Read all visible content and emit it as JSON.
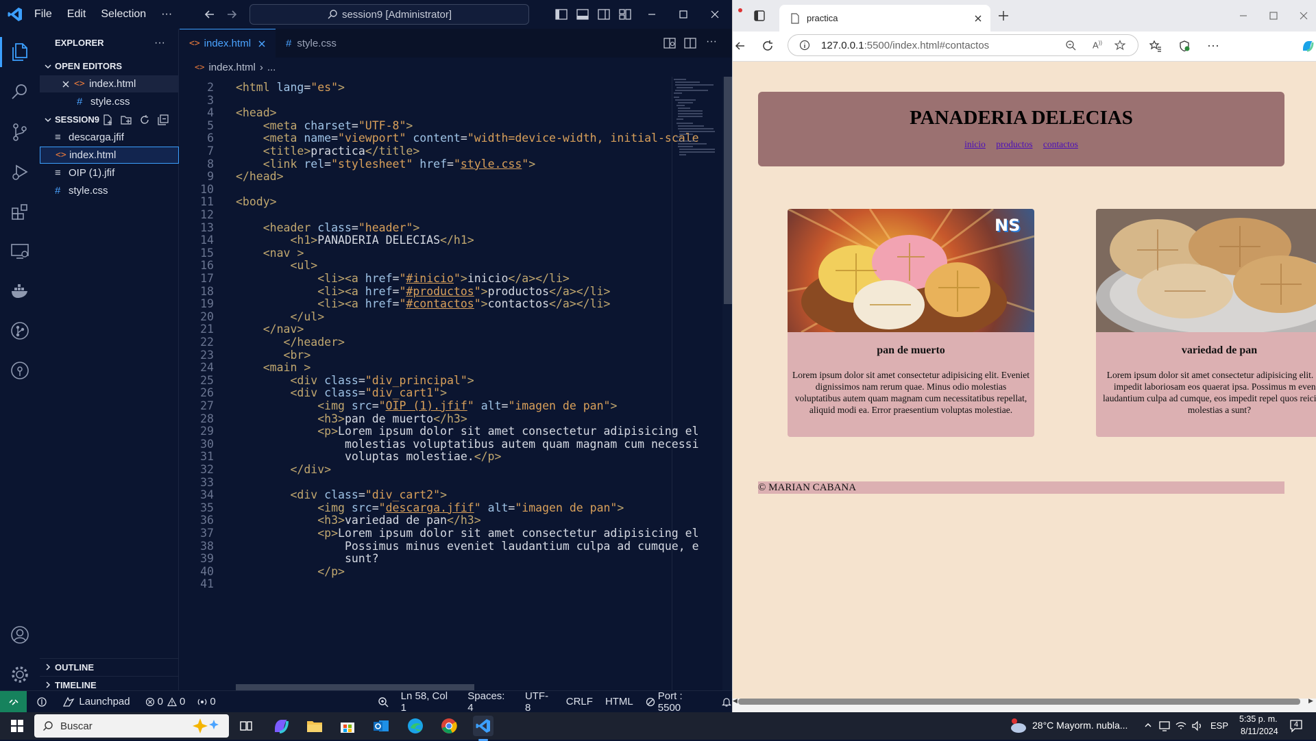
{
  "vscode": {
    "menu": [
      "File",
      "Edit",
      "Selection",
      "···"
    ],
    "command_center": "session9 [Administrator]",
    "explorer": {
      "title": "EXPLORER",
      "open_editors_label": "OPEN EDITORS",
      "open_editors": [
        "index.html",
        "style.css"
      ],
      "folder_label": "SESSION9",
      "files": [
        "descarga.jfif",
        "index.html",
        "OIP (1).jfif",
        "style.css"
      ],
      "outline_label": "OUTLINE",
      "timeline_label": "TIMELINE"
    },
    "tabs": [
      "index.html",
      "style.css"
    ],
    "breadcrumb": [
      "index.html",
      "..."
    ],
    "code_lines": [
      {
        "n": "2",
        "html": "<span class='tg'>&lt;html</span> <span class='at'>lang</span>=<span class='st'>\"es\"</span><span class='tg'>&gt;</span>"
      },
      {
        "n": "3",
        "html": ""
      },
      {
        "n": "4",
        "html": "<span class='tg'>&lt;head&gt;</span>"
      },
      {
        "n": "5",
        "html": "    <span class='tg'>&lt;meta</span> <span class='at'>charset</span>=<span class='st'>\"UTF-8\"</span><span class='tg'>&gt;</span>"
      },
      {
        "n": "6",
        "html": "    <span class='tg'>&lt;meta</span> <span class='at'>name</span>=<span class='st'>\"viewport\"</span> <span class='at'>content</span>=<span class='st'>\"width=device-width, initial-scale</span>"
      },
      {
        "n": "7",
        "html": "    <span class='tg'>&lt;title&gt;</span>practica<span class='tg'>&lt;/title&gt;</span>"
      },
      {
        "n": "8",
        "html": "    <span class='tg'>&lt;link</span> <span class='at'>rel</span>=<span class='st'>\"stylesheet\"</span> <span class='at'>href</span>=<span class='st'>\"</span><span class='lk'>style.css</span><span class='st'>\"</span><span class='tg'>&gt;</span>"
      },
      {
        "n": "9",
        "html": "<span class='tg'>&lt;/head&gt;</span>"
      },
      {
        "n": "10",
        "html": ""
      },
      {
        "n": "11",
        "html": "<span class='tg'>&lt;body&gt;</span>"
      },
      {
        "n": "12",
        "html": ""
      },
      {
        "n": "13",
        "html": "    <span class='tg'>&lt;header</span> <span class='at'>class</span>=<span class='st'>\"header\"</span><span class='tg'>&gt;</span>"
      },
      {
        "n": "14",
        "html": "        <span class='tg'>&lt;h1&gt;</span>PANADERIA DELECIAS<span class='tg'>&lt;/h1&gt;</span>"
      },
      {
        "n": "15",
        "html": "    <span class='tg'>&lt;nav</span> <span class='tg'>&gt;</span>"
      },
      {
        "n": "16",
        "html": "        <span class='tg'>&lt;ul&gt;</span>"
      },
      {
        "n": "17",
        "html": "            <span class='tg'>&lt;li&gt;&lt;a</span> <span class='at'>href</span>=<span class='st'>\"</span><span class='lk'>#inicio</span><span class='st'>\"</span><span class='tg'>&gt;</span>inicio<span class='tg'>&lt;/a&gt;&lt;/li&gt;</span>"
      },
      {
        "n": "18",
        "html": "            <span class='tg'>&lt;li&gt;&lt;a</span> <span class='at'>href</span>=<span class='st'>\"</span><span class='lk'>#productos</span><span class='st'>\"</span><span class='tg'>&gt;</span>productos<span class='tg'>&lt;/a&gt;&lt;/li&gt;</span>"
      },
      {
        "n": "19",
        "html": "            <span class='tg'>&lt;li&gt;&lt;a</span> <span class='at'>href</span>=<span class='st'>\"</span><span class='lk'>#contactos</span><span class='st'>\"</span><span class='tg'>&gt;</span>contactos<span class='tg'>&lt;/a&gt;&lt;/li&gt;</span>"
      },
      {
        "n": "20",
        "html": "        <span class='tg'>&lt;/ul&gt;</span>"
      },
      {
        "n": "21",
        "html": "    <span class='tg'>&lt;/nav&gt;</span>"
      },
      {
        "n": "22",
        "html": "       <span class='tg'>&lt;/header&gt;</span>"
      },
      {
        "n": "23",
        "html": "       <span class='tg'>&lt;br&gt;</span>"
      },
      {
        "n": "24",
        "html": "    <span class='tg'>&lt;main</span> <span class='tg'>&gt;</span>"
      },
      {
        "n": "25",
        "html": "        <span class='tg'>&lt;div</span> <span class='at'>class</span>=<span class='st'>\"div_principal\"</span><span class='tg'>&gt;</span>"
      },
      {
        "n": "26",
        "html": "        <span class='tg'>&lt;div</span> <span class='at'>class</span>=<span class='st'>\"div_cart1\"</span><span class='tg'>&gt;</span>"
      },
      {
        "n": "27",
        "html": "            <span class='tg'>&lt;img</span> <span class='at'>src</span>=<span class='st'>\"</span><span class='lk'>OIP (1).jfif</span><span class='st'>\"</span> <span class='at'>alt</span>=<span class='st'>\"imagen de pan\"</span><span class='tg'>&gt;</span>"
      },
      {
        "n": "28",
        "html": "            <span class='tg'>&lt;h3&gt;</span>pan de muerto<span class='tg'>&lt;/h3&gt;</span>"
      },
      {
        "n": "29",
        "html": "            <span class='tg'>&lt;p&gt;</span>Lorem ipsum dolor sit amet consectetur adipisicing el"
      },
      {
        "n": "30",
        "html": "                molestias voluptatibus autem quam magnam cum necessi"
      },
      {
        "n": "31",
        "html": "                voluptas molestiae.<span class='tg'>&lt;/p&gt;</span>"
      },
      {
        "n": "32",
        "html": "        <span class='tg'>&lt;/div&gt;</span>"
      },
      {
        "n": "33",
        "html": ""
      },
      {
        "n": "34",
        "html": "        <span class='tg'>&lt;div</span> <span class='at'>class</span>=<span class='st'>\"div_cart2\"</span><span class='tg'>&gt;</span>"
      },
      {
        "n": "35",
        "html": "            <span class='tg'>&lt;img</span> <span class='at'>src</span>=<span class='st'>\"</span><span class='lk'>descarga.jfif</span><span class='st'>\"</span> <span class='at'>alt</span>=<span class='st'>\"imagen de pan\"</span><span class='tg'>&gt;</span>"
      },
      {
        "n": "36",
        "html": "            <span class='tg'>&lt;h3&gt;</span>variedad de pan<span class='tg'>&lt;/h3&gt;</span>"
      },
      {
        "n": "37",
        "html": "            <span class='tg'>&lt;p&gt;</span>Lorem ipsum dolor sit amet consectetur adipisicing el"
      },
      {
        "n": "38",
        "html": "                Possimus minus eveniet laudantium culpa ad cumque, e"
      },
      {
        "n": "39",
        "html": "                sunt?"
      },
      {
        "n": "40",
        "html": "            <span class='tg'>&lt;/p&gt;</span>"
      },
      {
        "n": "41",
        "html": ""
      }
    ],
    "status": {
      "launchpad": "Launchpad",
      "errors": "0",
      "warnings": "0",
      "ports": "0",
      "position": "Ln 58, Col 1",
      "spaces": "Spaces: 4",
      "encoding": "UTF-8",
      "eol": "CRLF",
      "language": "HTML",
      "port": "Port : 5500"
    }
  },
  "browser": {
    "tab_title": "practica",
    "url_host": "127.0.0.1",
    "url_rest": ":5500/index.html#contactos",
    "page": {
      "title": "PANADERIA DELECIAS",
      "nav": [
        "inicio",
        "productos",
        "contactos"
      ],
      "cards": [
        {
          "title": "pan de muerto",
          "text": "Lorem ipsum dolor sit amet consectetur adipisicing elit. Eveniet dignissimos nam rerum quae. Minus odio molestias voluptatibus autem quam magnam cum necessitatibus repellat, aliquid modi ea. Error praesentium voluptas molestiae.",
          "badge": "NS"
        },
        {
          "title": "variedad de pan",
          "text": "Lorem ipsum dolor sit amet consectetur adipisicing elit. quo, impedit laboriosam eos quaerat ipsa. Possimus m eveniet laudantium culpa ad cumque, eos impedit repel quos reiciendis molestias a sunt?"
        }
      ],
      "footer": "© MARIAN CABANA"
    }
  },
  "taskbar": {
    "search_placeholder": "Buscar",
    "weather": "28°C  Mayorm. nubla...",
    "lang": "ESP",
    "time": "5:35 p. m.",
    "date": "8/11/2024",
    "notif_count": "4"
  },
  "colors": {
    "vscode_bg": "#0b1530",
    "accent": "#4aa3ff",
    "page_bg": "#f5e3ce",
    "header_bg": "#9b7171",
    "card_bg": "#dcb0b2"
  }
}
